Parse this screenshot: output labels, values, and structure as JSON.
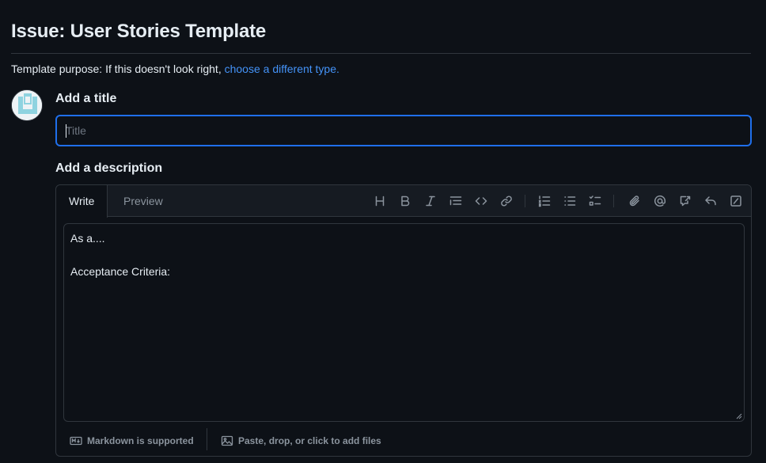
{
  "page": {
    "title": "Issue: User Stories Template",
    "purpose_text": "Template purpose: If this doesn't look right, ",
    "purpose_link": "choose a different type."
  },
  "title_field": {
    "label": "Add a title",
    "placeholder": "Title",
    "value": ""
  },
  "description": {
    "label": "Add a description",
    "tabs": {
      "write": "Write",
      "preview": "Preview"
    },
    "toolbar_icons": [
      "heading-icon",
      "bold-icon",
      "italic-icon",
      "quote-icon",
      "code-icon",
      "link-icon",
      "ordered-list-icon",
      "unordered-list-icon",
      "task-list-icon",
      "attach-icon",
      "mention-icon",
      "reference-icon",
      "reply-icon",
      "slash-command-icon"
    ],
    "body_lines": [
      "As a....",
      "",
      "Acceptance Criteria:"
    ],
    "footer": {
      "markdown": "Markdown is supported",
      "files": "Paste, drop, or click to add files"
    }
  },
  "colors": {
    "background": "#0d1117",
    "border": "#30363d",
    "focus": "#1f6feb",
    "link": "#4493f8",
    "text": "#e6edf3",
    "muted": "#8b949e"
  }
}
